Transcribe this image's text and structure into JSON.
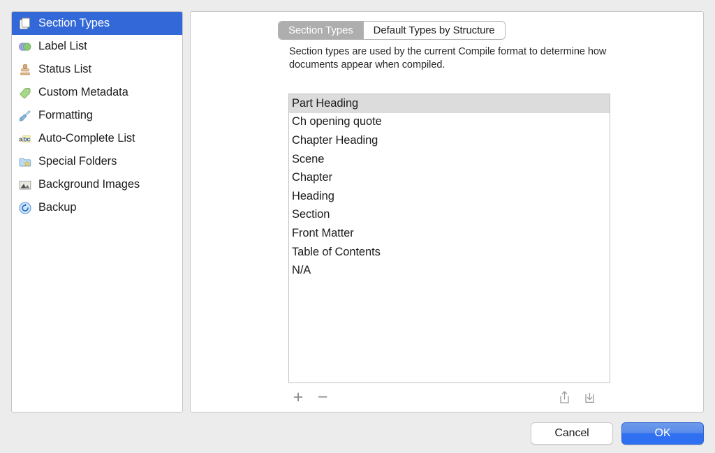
{
  "sidebar": {
    "items": [
      {
        "label": "Section Types",
        "icon": "documents-icon",
        "selected": true
      },
      {
        "label": "Label List",
        "icon": "color-circles-icon",
        "selected": false
      },
      {
        "label": "Status List",
        "icon": "rubber-stamp-icon",
        "selected": false
      },
      {
        "label": "Custom Metadata",
        "icon": "green-tag-icon",
        "selected": false
      },
      {
        "label": "Formatting",
        "icon": "paintbrush-icon",
        "selected": false
      },
      {
        "label": "Auto-Complete List",
        "icon": "abc-icon",
        "selected": false
      },
      {
        "label": "Special Folders",
        "icon": "folder-star-icon",
        "selected": false
      },
      {
        "label": "Background Images",
        "icon": "picture-icon",
        "selected": false
      },
      {
        "label": "Backup",
        "icon": "backup-circle-icon",
        "selected": false
      }
    ]
  },
  "main": {
    "tabs": [
      {
        "label": "Section Types",
        "active": true
      },
      {
        "label": "Default Types by Structure",
        "active": false
      }
    ],
    "description": "Section types are used by the current Compile format to determine how documents appear when compiled.",
    "list": {
      "rows": [
        {
          "label": "Part Heading",
          "selected": true
        },
        {
          "label": "Ch opening quote",
          "selected": false
        },
        {
          "label": "Chapter Heading",
          "selected": false
        },
        {
          "label": "Scene",
          "selected": false
        },
        {
          "label": "Chapter",
          "selected": false
        },
        {
          "label": "Heading",
          "selected": false
        },
        {
          "label": "Section",
          "selected": false
        },
        {
          "label": "Front Matter",
          "selected": false
        },
        {
          "label": "Table of Contents",
          "selected": false
        },
        {
          "label": "N/A",
          "selected": false
        }
      ]
    },
    "toolbar": {
      "add_label": "+",
      "remove_label": "−",
      "export_icon": "export-share-icon",
      "import_icon": "import-download-icon"
    }
  },
  "footer": {
    "cancel_label": "Cancel",
    "ok_label": "OK"
  },
  "colors": {
    "selection_blue": "#3268d8",
    "tab_active_gray": "#aeaeae",
    "list_selection_gray": "#dcdcdc",
    "ok_button_blue": "#2f6ff1",
    "window_background": "#ececec"
  }
}
